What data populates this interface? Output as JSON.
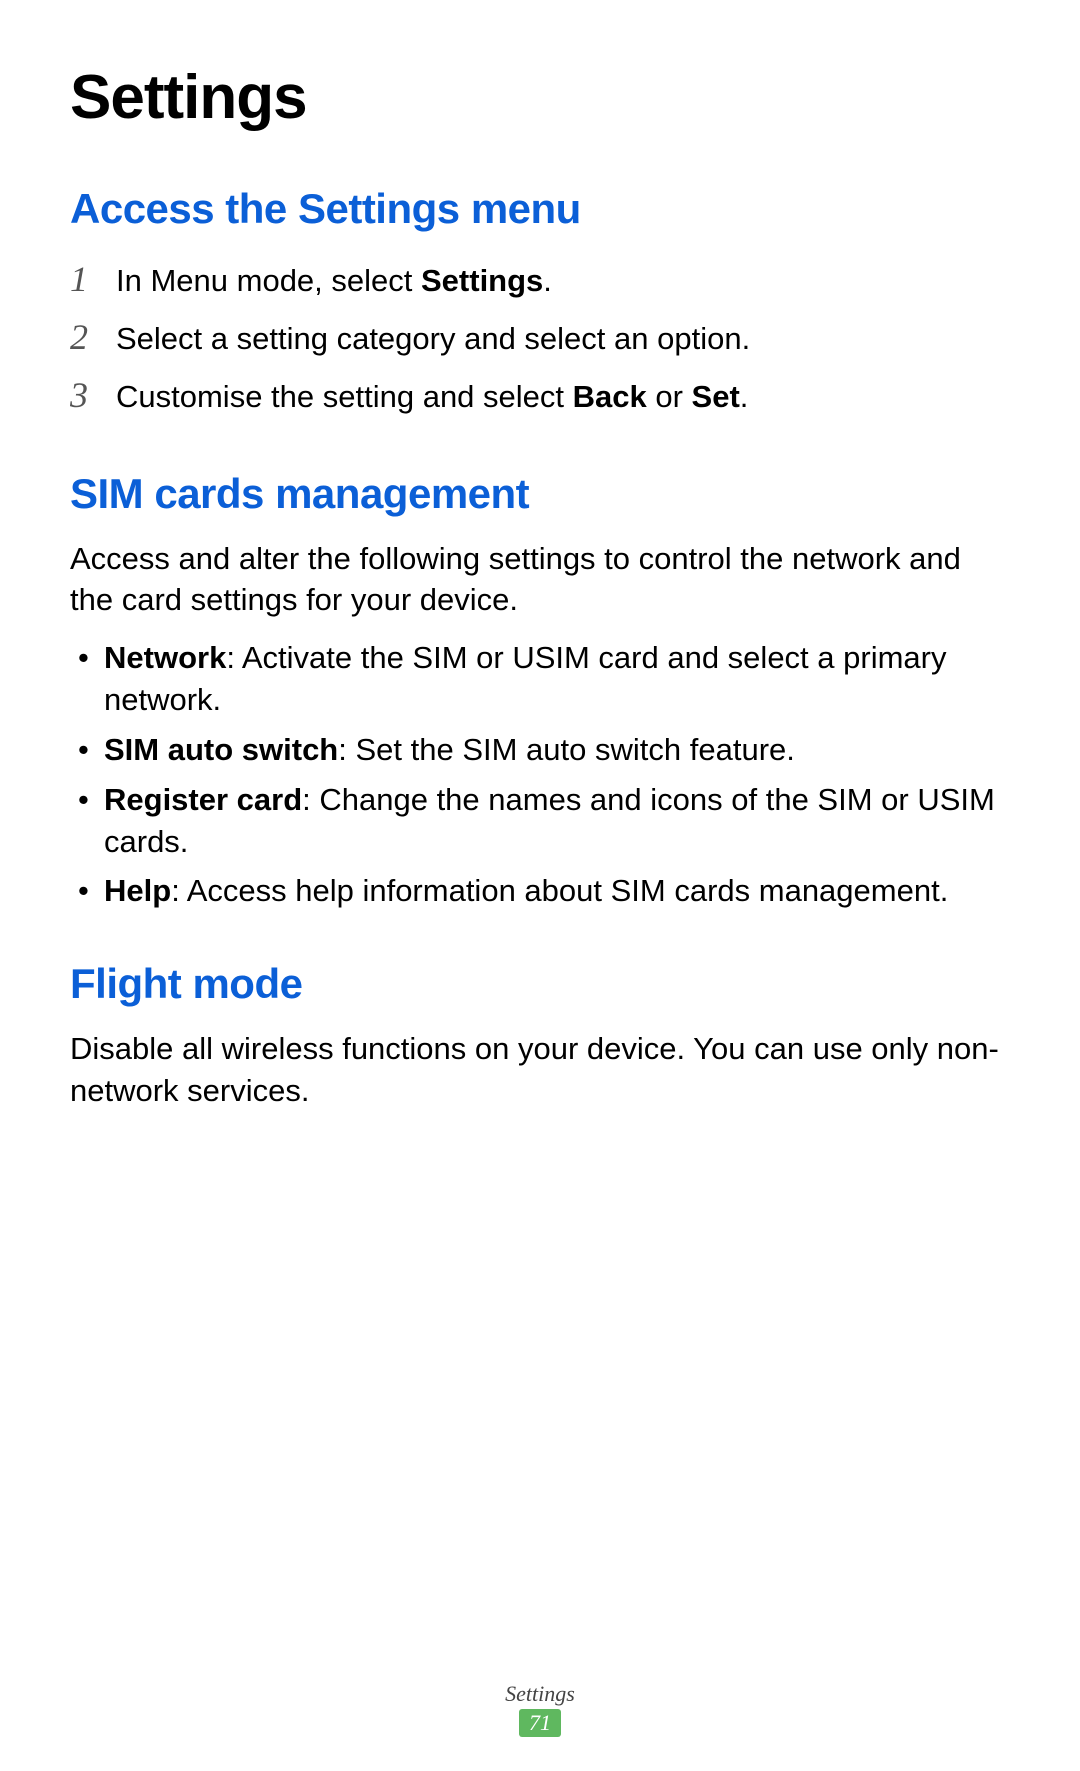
{
  "page": {
    "title": "Settings"
  },
  "sections": {
    "access": {
      "heading": "Access the Settings menu",
      "steps": [
        {
          "num": "1",
          "pre": "In Menu mode, select ",
          "bold": "Settings",
          "post": "."
        },
        {
          "num": "2",
          "pre": "Select a setting category and select an option.",
          "bold": "",
          "post": ""
        },
        {
          "num": "3",
          "pre": "Customise the setting and select ",
          "bold": "Back",
          "mid": " or ",
          "bold2": "Set",
          "post": "."
        }
      ]
    },
    "sim": {
      "heading": "SIM cards management",
      "intro": "Access and alter the following settings to control the network and the card settings for your device.",
      "bullets": [
        {
          "bold": "Network",
          "text": ": Activate the SIM or USIM card and select a primary network."
        },
        {
          "bold": "SIM auto switch",
          "text": ": Set the SIM auto switch feature."
        },
        {
          "bold": "Register card",
          "text": ": Change the names and icons of the SIM or USIM cards."
        },
        {
          "bold": "Help",
          "text": ": Access help information about SIM cards management."
        }
      ]
    },
    "flight": {
      "heading": "Flight mode",
      "intro": "Disable all wireless functions on your device. You can use only non-network services."
    }
  },
  "footer": {
    "label": "Settings",
    "page": "71"
  }
}
